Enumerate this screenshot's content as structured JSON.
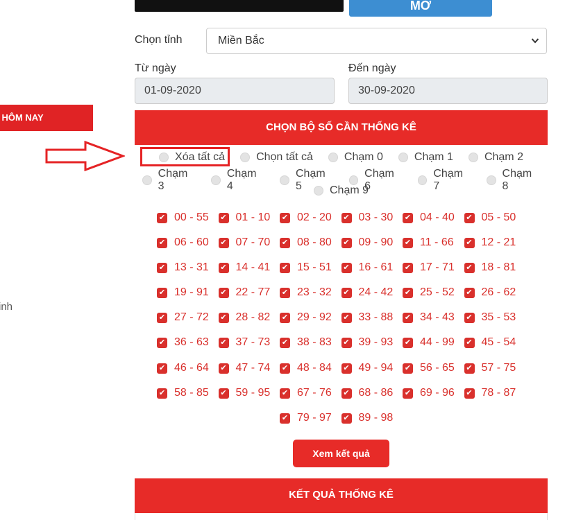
{
  "top": {
    "open_button_label": "MỞ"
  },
  "sidebar": {
    "banner_label": "M HÔM NAY",
    "partial_text": "inh"
  },
  "form": {
    "province_label": "Chọn tỉnh",
    "province_value": "Miền Bắc",
    "from_label": "Từ ngày",
    "from_value": "01-09-2020",
    "to_label": "Đến ngày",
    "to_value": "30-09-2020"
  },
  "choose_header": "CHỌN BỘ SỐ CẦN THỐNG KÊ",
  "radio_options": [
    "Xóa tất cả",
    "Chọn tất cả",
    "Chạm 0",
    "Chạm 1",
    "Chạm 2",
    "Chạm 3",
    "Chạm 4",
    "Chạm 5",
    "Chạm 6",
    "Chạm 7",
    "Chạm 8",
    "Chạm 9"
  ],
  "pairs": [
    "00 - 55",
    "01 - 10",
    "02 - 20",
    "03 - 30",
    "04 - 40",
    "05 - 50",
    "06 - 60",
    "07 - 70",
    "08 - 80",
    "09 - 90",
    "11 - 66",
    "12 - 21",
    "13 - 31",
    "14 - 41",
    "15 - 51",
    "16 - 61",
    "17 - 71",
    "18 - 81",
    "19 - 91",
    "22 - 77",
    "23 - 32",
    "24 - 42",
    "25 - 52",
    "26 - 62",
    "27 - 72",
    "28 - 82",
    "29 - 92",
    "33 - 88",
    "34 - 43",
    "35 - 53",
    "36 - 63",
    "37 - 73",
    "38 - 83",
    "39 - 93",
    "44 - 99",
    "45 - 54",
    "46 - 64",
    "47 - 74",
    "48 - 84",
    "49 - 94",
    "56 - 65",
    "57 - 75",
    "58 - 85",
    "59 - 95",
    "67 - 76",
    "68 - 86",
    "69 - 96",
    "78 - 87",
    "79 - 97",
    "89 - 98"
  ],
  "pairs_checked": true,
  "view_result_label": "Xem kết quả",
  "result_header": "KẾT QUẢ THỐNG KÊ",
  "icons": {
    "check": "checkmark-icon",
    "arrow": "arrow-right-outline-icon"
  },
  "colors": {
    "accent_red": "#e72b28",
    "pair_red": "#d9302c",
    "button_blue": "#3d8ed2"
  }
}
